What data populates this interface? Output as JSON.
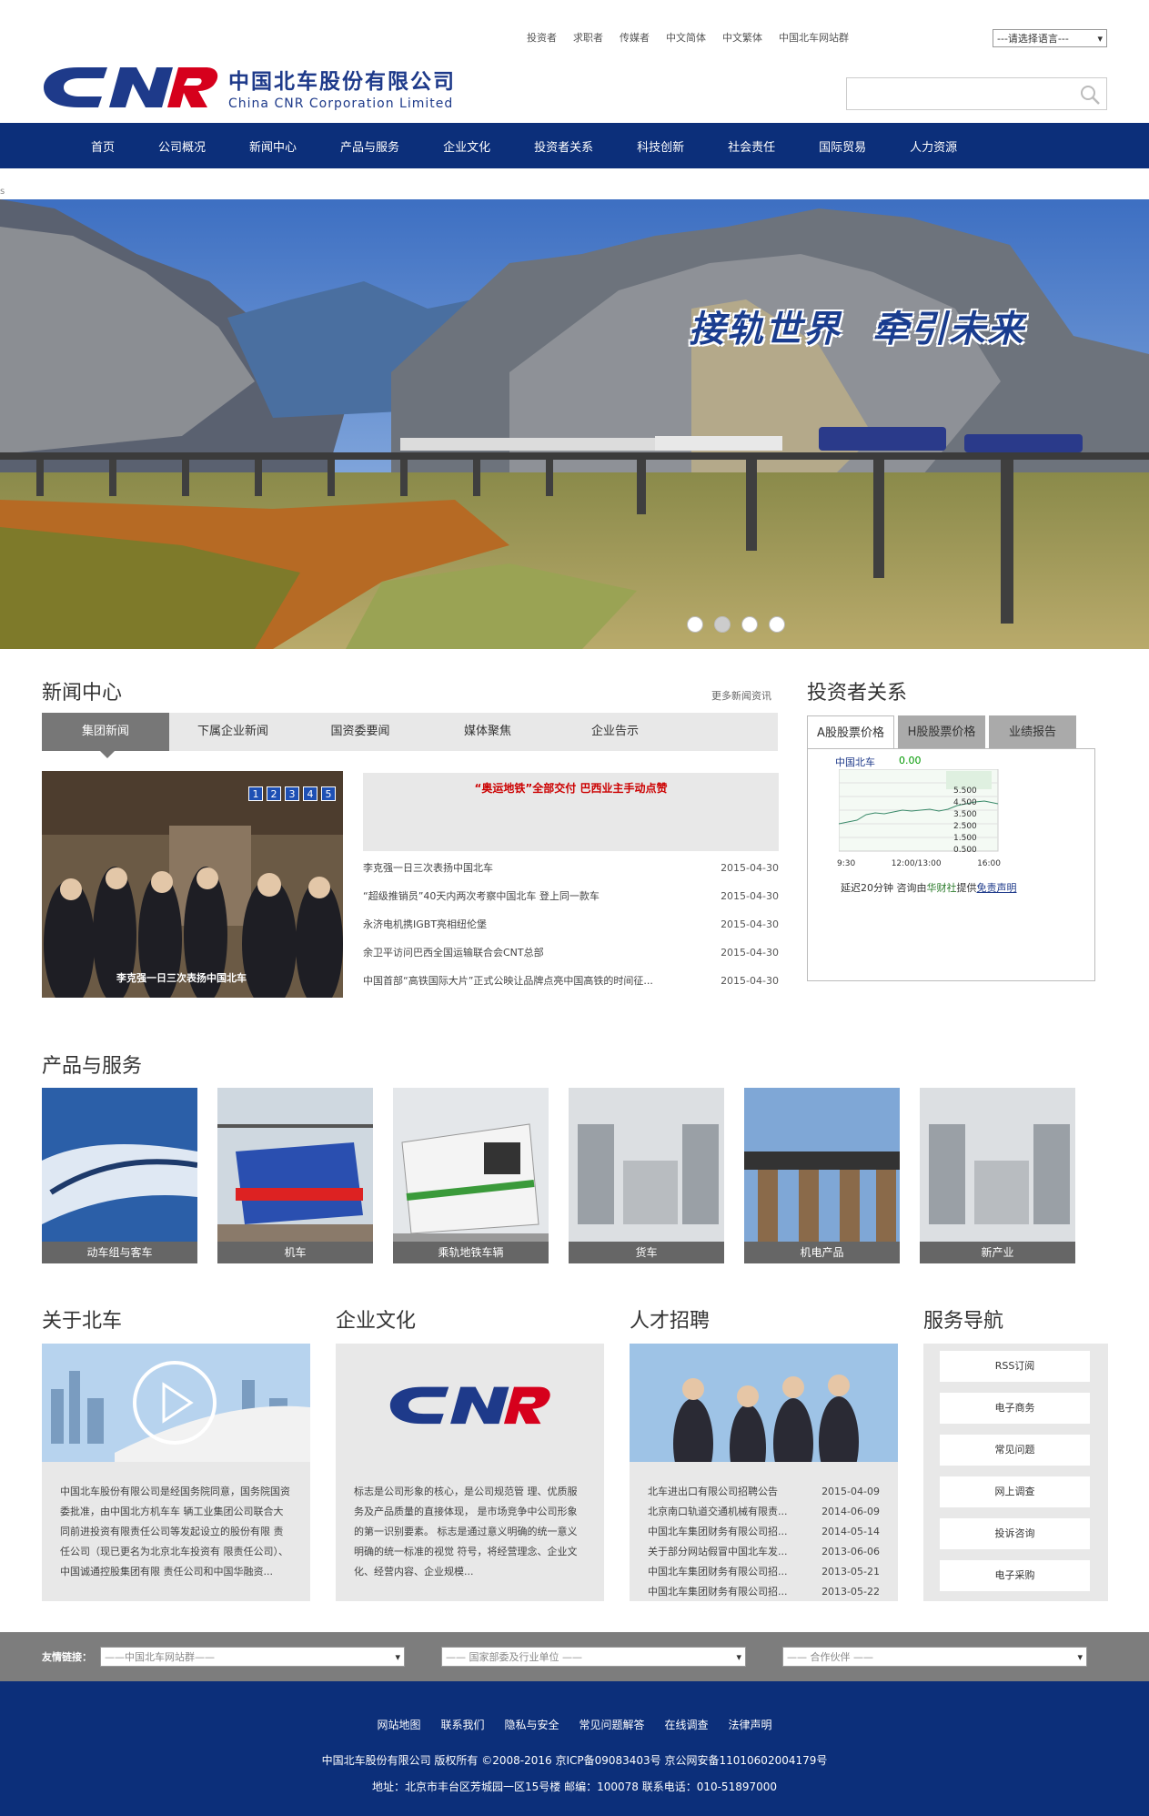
{
  "header": {
    "top_links": [
      "投资者",
      "求职者",
      "传媒者",
      "中文简体",
      "中文繁体",
      "中国北车网站群"
    ],
    "language_select": "---请选择语言---",
    "logo_cn": "中国北车股份有限公司",
    "logo_en": "China CNR Corporation Limited",
    "search_placeholder": ""
  },
  "nav": [
    "首页",
    "公司概况",
    "新闻中心",
    "产品与服务",
    "企业文化",
    "投资者关系",
    "科技创新",
    "社会责任",
    "国际贸易",
    "人力资源"
  ],
  "subline": "s",
  "banner": {
    "slogan_1": "接轨世界",
    "slogan_2": "牵引未来",
    "dots": 4
  },
  "news": {
    "title": "新闻中心",
    "more": "更多新闻资讯",
    "tabs": [
      "集团新闻",
      "下属企业新闻",
      "国资委要闻",
      "媒体聚焦",
      "企业告示"
    ],
    "photo_caption": "李克强一日三次表扬中国北车",
    "photo_nums": [
      "1",
      "2",
      "3",
      "4",
      "5"
    ],
    "headline": "“奥运地铁”全部交付 巴西业主手动点赞",
    "items": [
      {
        "title": "李克强一日三次表扬中国北车",
        "date": "2015-04-30"
      },
      {
        "title": "“超级推销员”40天内两次考察中国北车 登上同一款车",
        "date": "2015-04-30"
      },
      {
        "title": "永济电机携IGBT亮相纽伦堡",
        "date": "2015-04-30"
      },
      {
        "title": "余卫平访问巴西全国运输联合会CNT总部",
        "date": "2015-04-30"
      },
      {
        "title": "中国首部“高铁国际大片”正式公映让品牌点亮中国高铁的时间征...",
        "date": "2015-04-30"
      }
    ]
  },
  "investor": {
    "title": "投资者关系",
    "tabs": [
      "A股股票价格",
      "H股股票价格",
      "业绩报告"
    ],
    "stock_name": "中国北车",
    "stock_value": "0.00",
    "y_ticks": [
      "5.500",
      "4.500",
      "3.500",
      "2.500",
      "1.500",
      "0.500"
    ],
    "x_ticks": [
      "9:30",
      "12:00/13:00",
      "16:00"
    ],
    "note_prefix": "延迟20分钟   咨询由",
    "note_source": "华财社",
    "note_mid": "提供",
    "note_link": "免责声明"
  },
  "products": {
    "title": "产品与服务",
    "items": [
      "动车组与客车",
      "机车",
      "乘轨地铁车辆",
      "货车",
      "机电产品",
      "新产业"
    ]
  },
  "about": {
    "title": "关于北车",
    "text": "中国北车股份有限公司是经国务院同意，国务院国资委批准，由中国北方机车车 辆工业集团公司联合大同前进投资有限责任公司等发起设立的股份有限 责任公司（现已更名为北京北车投资有 限责任公司）、中国诚通控股集团有限 责任公司和中国华融资..."
  },
  "culture": {
    "title": "企业文化",
    "text": "标志是公司形象的核心，是公司规范管 理、优质服务及产品质量的直接体现， 是市场竞争中公司形象的第一识别要素。 标志是通过意义明确的统一意义明确的统一标准的视觉 符号，将经营理念、企业文化、经营内容、企业规模..."
  },
  "jobs": {
    "title": "人才招聘",
    "items": [
      {
        "title": "北车进出口有限公司招聘公告",
        "date": "2015-04-09"
      },
      {
        "title": "北京南口轨道交通机械有限责...",
        "date": "2014-06-09"
      },
      {
        "title": "中国北车集团财务有限公司招...",
        "date": "2014-05-14"
      },
      {
        "title": "关于部分网站假冒中国北车发...",
        "date": "2013-06-06"
      },
      {
        "title": "中国北车集团财务有限公司招...",
        "date": "2013-05-21"
      },
      {
        "title": "中国北车集团财务有限公司招...",
        "date": "2013-05-22"
      }
    ]
  },
  "services": {
    "title": "服务导航",
    "items": [
      "RSS订阅",
      "电子商务",
      "常见问题",
      "网上调查",
      "投诉咨询",
      "电子采购"
    ]
  },
  "links": {
    "label": "友情链接：",
    "selects": [
      "——中国北车网站群——",
      "—— 国家部委及行业单位 ——",
      "—— 合作伙伴 ——"
    ]
  },
  "footer": {
    "links": [
      "网站地图",
      "联系我们",
      "隐私与安全",
      "常见问题解答",
      "在线调查",
      "法律声明"
    ],
    "copyright": "中国北车股份有限公司 版权所有 ©2008-2016   京ICP备09083403号   京公网安备11010602004179号",
    "address": "地址：北京市丰台区芳城园一区15号楼   邮编：100078   联系电话：010-51897000"
  },
  "colors": {
    "brand_blue": "#0c2f7a",
    "logo_red": "#d6001c"
  }
}
